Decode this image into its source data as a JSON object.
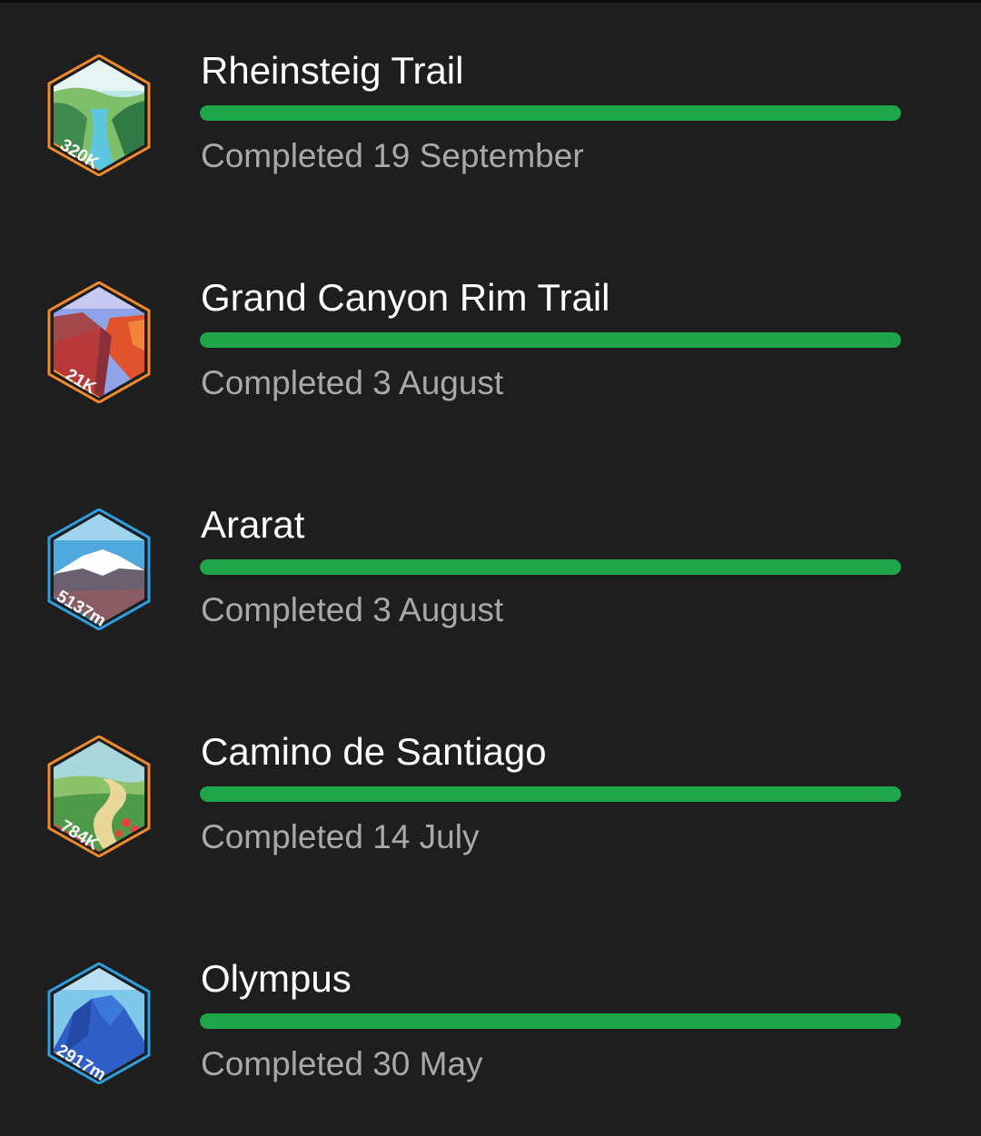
{
  "challenges": [
    {
      "name": "Rheinsteig Trail",
      "status": "Completed 19 September",
      "progress": 1.0,
      "badge": {
        "icon": "river-valley-icon",
        "label": "320K",
        "border": "#f28a2c",
        "ribbon": "#f0892a"
      }
    },
    {
      "name": "Grand Canyon Rim Trail",
      "status": "Completed 3 August",
      "progress": 1.0,
      "badge": {
        "icon": "canyon-icon",
        "label": "21K",
        "border": "#f28a2c",
        "ribbon": "#f5a12b"
      }
    },
    {
      "name": "Ararat",
      "status": "Completed 3 August",
      "progress": 1.0,
      "badge": {
        "icon": "snowy-mountain-icon",
        "label": "5137m",
        "border": "#2e9fe0",
        "ribbon": "#2a92d8"
      }
    },
    {
      "name": "Camino de Santiago",
      "status": "Completed 14 July",
      "progress": 1.0,
      "badge": {
        "icon": "countryside-path-icon",
        "label": "784K",
        "border": "#f28a2c",
        "ribbon": "#e8423d"
      }
    },
    {
      "name": "Olympus",
      "status": "Completed 30 May",
      "progress": 1.0,
      "badge": {
        "icon": "blue-mountain-icon",
        "label": "2917m",
        "border": "#2e9fe0",
        "ribbon": "#2a92d8"
      }
    }
  ],
  "colors": {
    "background": "#1e1e1f",
    "progress_fill": "#1fa64b",
    "title": "#ffffff",
    "subtitle": "#a9a9a9"
  }
}
